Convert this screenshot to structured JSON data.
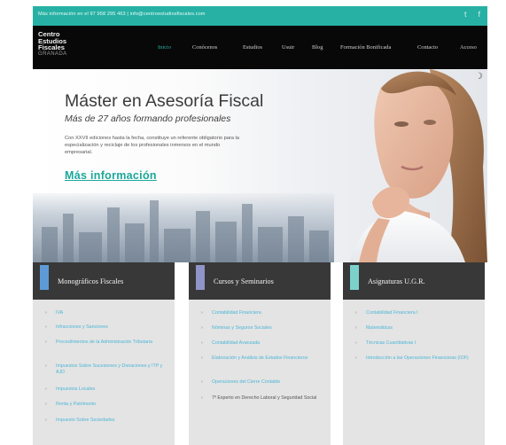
{
  "colors": {
    "teal": "#27b1a4",
    "black": "#080808",
    "link_blue": "#4cb6d6",
    "ribbon_blue": "#5e9bd6",
    "ribbon_lavender": "#8f95c9",
    "ribbon_teal": "#7cd2cb"
  },
  "topbar": {
    "info": "Más información en el 97 958 295 463  |  info@centroestudiosfiscales.com",
    "twitter_icon": "t",
    "facebook_icon": "f"
  },
  "logo": {
    "line1": "Centro",
    "line2": "Estudios",
    "line3": "Fiscales",
    "city": "GRANADA"
  },
  "nav": {
    "items": [
      "Inicio",
      "Conócenos",
      "Estudios",
      "Usuir",
      "Blog",
      "Formación Bonificada",
      "Contacto",
      "Acceso"
    ],
    "active": "Inicio"
  },
  "hero": {
    "title": "Máster en Asesoría Fiscal",
    "subtitle": "Más de 27 años formando profesionales",
    "description": "Con XXVII ediciones hasta la fecha, constituye un referente obligatorio para la especialización y reciclaje de los profesionales inmersos en el mundo empresarial.",
    "cta": "Más información"
  },
  "columns": [
    {
      "title": "Monográficos Fiscales",
      "ribbon": "blue",
      "items": [
        "IVA",
        "Infracciones y Sanciones",
        "Procedimientos de la Administración Tributaria",
        "Impuestos Sobre Sucesiones y Donaciones y ITP y AJD",
        "Impuestos Locales",
        "Renta y Patrimonio",
        "Impuesto Sobre Sociedades"
      ]
    },
    {
      "title": "Cursos y Seminarios",
      "ribbon": "lavender",
      "items": [
        "Contabilidad Financiera",
        "Nóminas y Seguros Sociales",
        "Contabilidad Avanzada",
        "Elaboración y Análisis de Estados Financieros",
        "Operaciones del Cierre Contable",
        "7º Experto en Derecho Laboral y Seguridad Social"
      ]
    },
    {
      "title": "Asignaturas U.G.R.",
      "ribbon": "teal",
      "items": [
        "Contabilidad Financiera I",
        "Matemáticas",
        "Técnicas Cuantitativas I",
        "Introducción a las Operaciones Financieras (IOF)"
      ]
    }
  ]
}
